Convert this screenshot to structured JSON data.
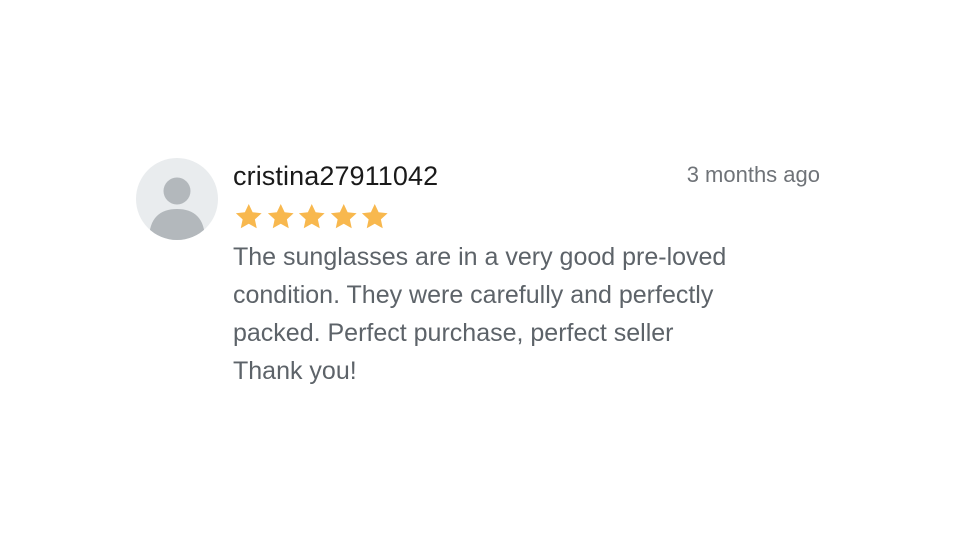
{
  "review": {
    "username": "cristina27911042",
    "timestamp": "3 months ago",
    "rating": 5,
    "rating_max": 5,
    "text": "The sunglasses are in a very good pre-loved\ncondition. They were carefully and perfectly\npacked. Perfect purchase, perfect seller\nThank you!",
    "avatar_icon": "default-user-avatar-icon",
    "star_icon": "star-icon"
  },
  "colors": {
    "star": "#f8b84e",
    "avatar_bg": "#e9ecee",
    "avatar_figure": "#b3b8bc",
    "username": "#1a1a1a",
    "body_text": "#5d6369",
    "timestamp": "#6f7378"
  }
}
